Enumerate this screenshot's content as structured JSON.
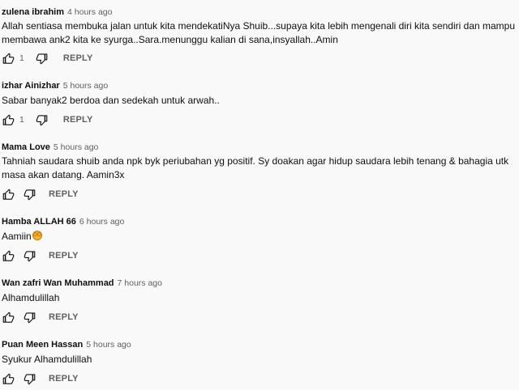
{
  "comments": [
    {
      "author": "zulena ibrahim",
      "time": "4 hours ago",
      "text": "Allah sentiasa membuka jalan untuk kita mendekatiNya Shuib...supaya kita lebih mengenali  diri kita  sendiri dan mampu membawa ank2 kita ke syurga..Sara.menunggu kalian di sana,insyallah..Amin",
      "likes": "1",
      "reply": "REPLY"
    },
    {
      "author": "izhar Ainizhar",
      "time": "5 hours ago",
      "text": "Sabar banyak2 berdoa dan sedekah untuk arwah..",
      "likes": "1",
      "reply": "REPLY"
    },
    {
      "author": "Mama Love",
      "time": "5 hours ago",
      "text": "Tahniah saudara shuib anda npk byk periubahan yg positif. Sy doakan agar hidup saudara lebih tenang & bahagia utk masa akan datang. Aamin3x",
      "likes": "",
      "reply": "REPLY"
    },
    {
      "author": "Hamba ALLAH 66",
      "time": "6 hours ago",
      "text": "Aamiin",
      "likes": "",
      "reply": "REPLY"
    },
    {
      "author": "Wan zafri Wan Muhammad",
      "time": "7 hours ago",
      "text": "Alhamdulillah",
      "likes": "",
      "reply": "REPLY"
    },
    {
      "author": "Puan Meen Hassan",
      "time": "5 hours ago",
      "text": "Syukur Alhamdulillah",
      "likes": "",
      "reply": "REPLY"
    }
  ],
  "icons": {
    "like": "thumb-up-icon",
    "dislike": "thumb-down-icon",
    "emoji": "hands-emoji-icon"
  },
  "colors": {
    "background": "#f9f9f9",
    "text": "#0f0f0f",
    "secondary": "#606060",
    "emoji": "#f5b335"
  }
}
